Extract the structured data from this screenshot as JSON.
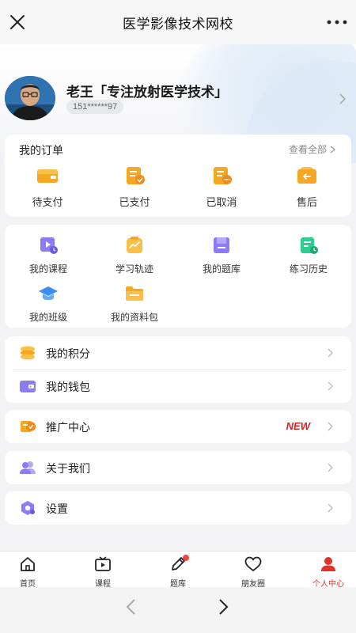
{
  "header": {
    "title": "医学影像技术网校",
    "close_icon": "close-icon",
    "more_icon": "more-dots-icon"
  },
  "profile": {
    "name": "老王「专注放射医学技术」",
    "phone": "151******97"
  },
  "orders": {
    "title": "我的订单",
    "view_all": "查看全部",
    "items": [
      {
        "label": "待支付",
        "icon": "wallet-icon"
      },
      {
        "label": "已支付",
        "icon": "paid-order-icon"
      },
      {
        "label": "已取消",
        "icon": "cancelled-order-icon"
      },
      {
        "label": "售后",
        "icon": "after-sales-icon"
      }
    ]
  },
  "features": [
    {
      "label": "我的课程",
      "icon": "course-play-icon"
    },
    {
      "label": "学习轨迹",
      "icon": "learning-track-icon"
    },
    {
      "label": "我的题库",
      "icon": "question-bank-icon"
    },
    {
      "label": "练习历史",
      "icon": "practice-history-icon"
    },
    {
      "label": "我的班级",
      "icon": "graduation-cap-icon"
    },
    {
      "label": "我的资料包",
      "icon": "folder-icon"
    }
  ],
  "menu": {
    "points": "我的积分",
    "wallet": "我的钱包",
    "promotion": "推广中心",
    "promotion_badge": "NEW",
    "about": "关于我们",
    "settings": "设置"
  },
  "tabbar": [
    {
      "label": "首页",
      "icon": "home-icon"
    },
    {
      "label": "课程",
      "icon": "tv-icon"
    },
    {
      "label": "题库",
      "icon": "pencil-icon"
    },
    {
      "label": "朋友圈",
      "icon": "heart-icon"
    },
    {
      "label": "个人中心",
      "icon": "person-icon"
    }
  ],
  "colors": {
    "accent_red": "#e0322a",
    "orange": "#f5a623",
    "purple": "#8b7cf6",
    "green": "#2ecc8f"
  }
}
